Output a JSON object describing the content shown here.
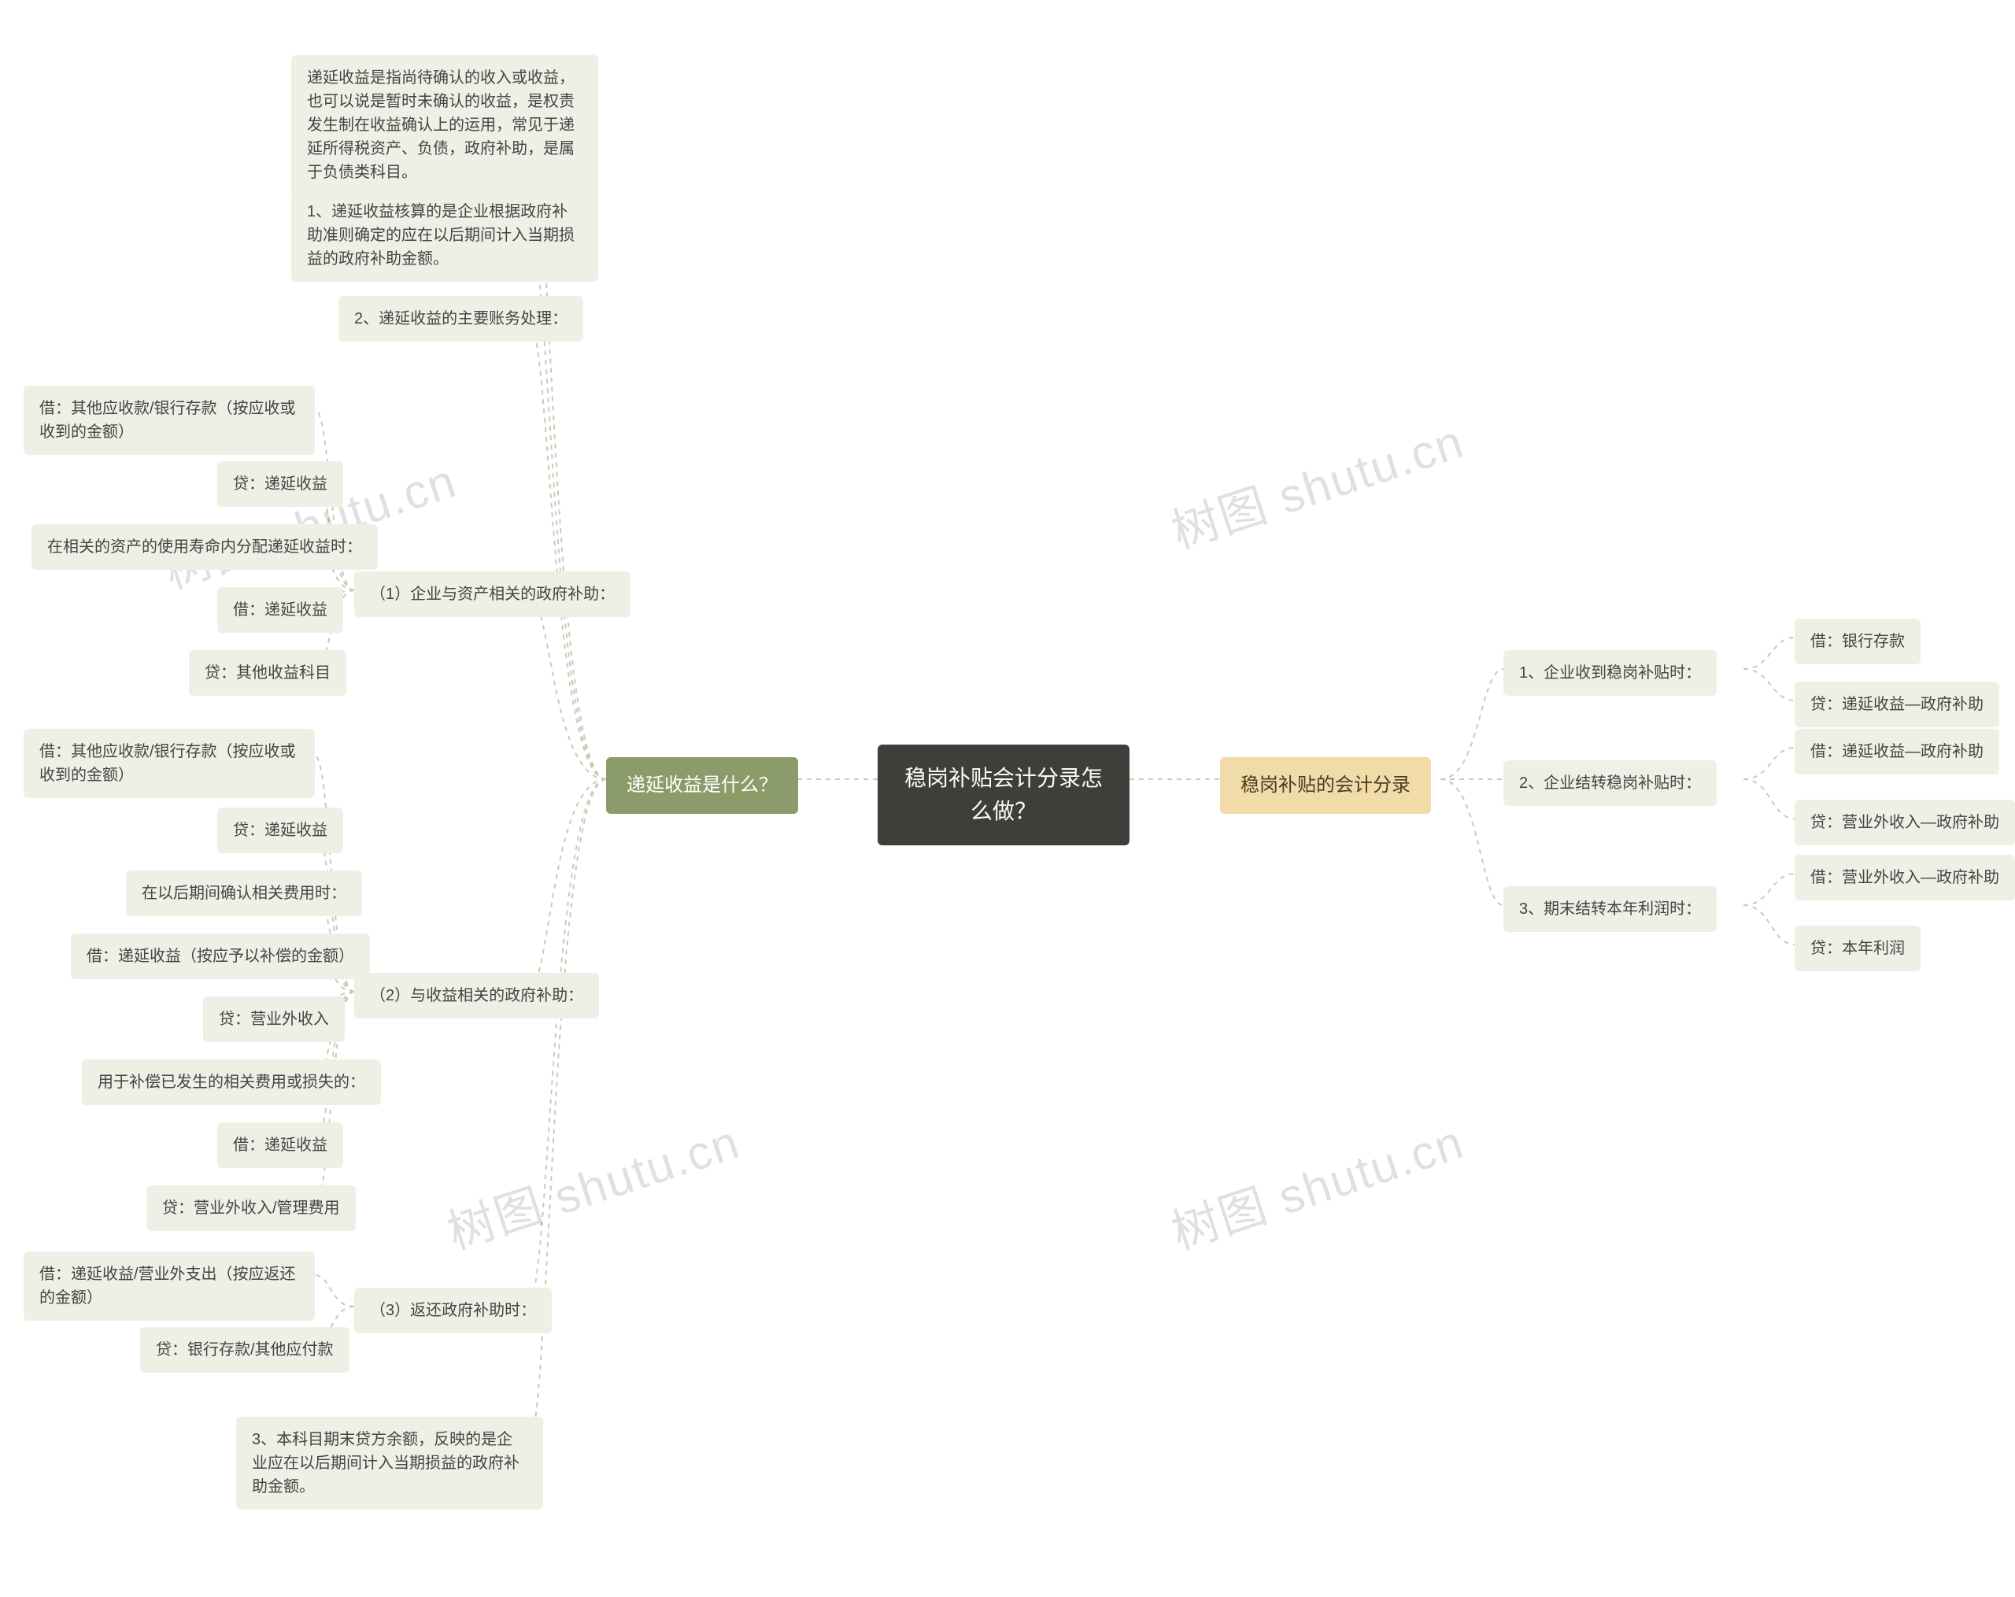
{
  "root": {
    "title": "稳岗补贴会计分录怎么做？"
  },
  "branches": {
    "left": {
      "label": "递延收益是什么？"
    },
    "right": {
      "label": "稳岗补贴的会计分录"
    }
  },
  "left": {
    "intro": "递延收益是指尚待确认的收入或收益，也可以说是暂时未确认的收益，是权责发生制在收益确认上的运用，常见于递延所得税资产、负债，政府补助，是属于负债类科目。",
    "point1": "1、递延收益核算的是企业根据政府补助准则确定的应在以后期间计入当期损益的政府补助金额。",
    "point2": "2、递延收益的主要账务处理：",
    "sub1": {
      "title": "（1）企业与资产相关的政府补助：",
      "l1": "借：其他应收款/银行存款（按应收或收到的金额）",
      "l2": "贷：递延收益",
      "l3": "在相关的资产的使用寿命内分配递延收益时：",
      "l4": "借：递延收益",
      "l5": "贷：其他收益科目"
    },
    "sub2": {
      "title": "（2）与收益相关的政府补助：",
      "l1": "借：其他应收款/银行存款（按应收或收到的金额）",
      "l2": "贷：递延收益",
      "l3": "在以后期间确认相关费用时：",
      "l4": "借：递延收益（按应予以补偿的金额）",
      "l5": "贷：营业外收入",
      "l6": "用于补偿已发生的相关费用或损失的：",
      "l7": "借：递延收益",
      "l8": "贷：营业外收入/管理费用"
    },
    "sub3": {
      "title": "（3）返还政府补助时：",
      "l1": "借：递延收益/营业外支出（按应返还的金额）",
      "l2": "贷：银行存款/其他应付款"
    },
    "point3": "3、本科目期末贷方余额，反映的是企业应在以后期间计入当期损益的政府补助金额。"
  },
  "right": {
    "r1": {
      "title": "1、企业收到稳岗补贴时：",
      "l1": "借：银行存款",
      "l2": "贷：递延收益—政府补助"
    },
    "r2": {
      "title": "2、企业结转稳岗补贴时：",
      "l1": "借：递延收益—政府补助",
      "l2": "贷：营业外收入—政府补助"
    },
    "r3": {
      "title": "3、期末结转本年利润时：",
      "l1": "借：营业外收入—政府补助",
      "l2": "贷：本年利润"
    }
  },
  "watermark": "树图 shutu.cn"
}
